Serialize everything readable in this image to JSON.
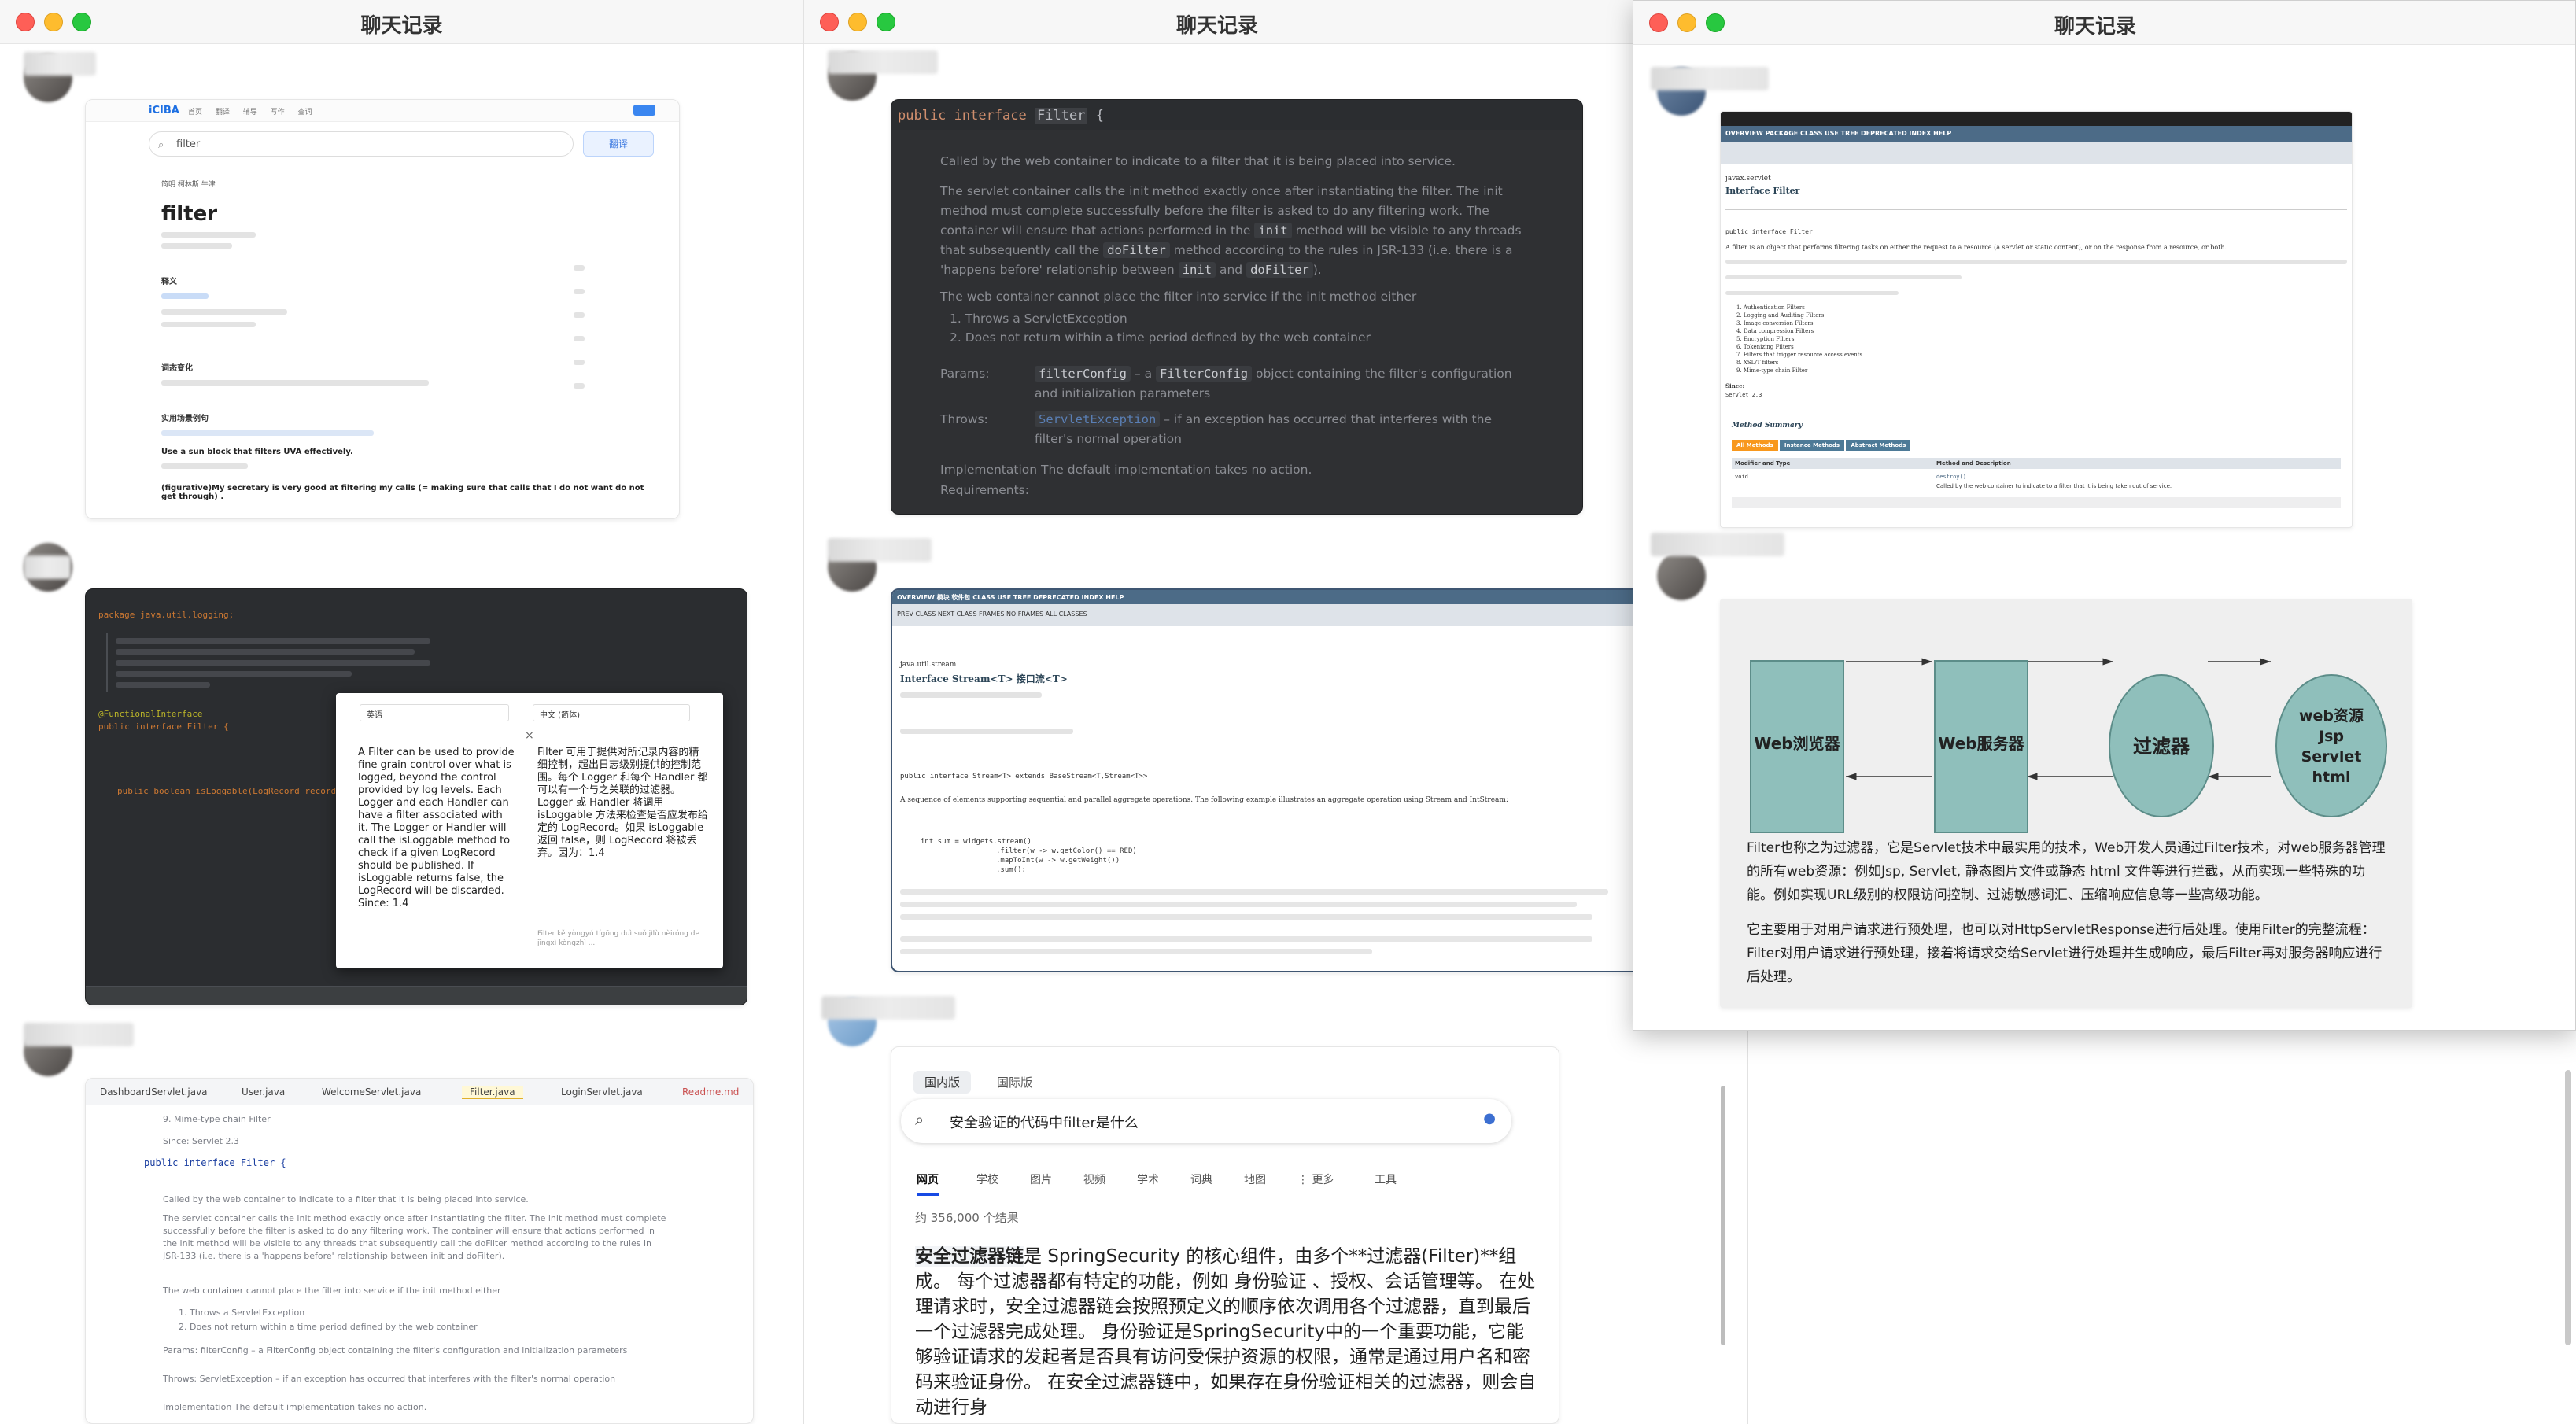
{
  "windows": [
    {
      "title": "聊天记录"
    },
    {
      "title": "聊天记录"
    },
    {
      "title": "聊天记录"
    }
  ],
  "dict": {
    "logo": "iCIBA",
    "nav": "首页 翻译 辅导 写作 查词",
    "search": "filter",
    "button": "翻译",
    "tabs": "简明 柯林斯 牛津",
    "word": "filter",
    "section1": "释义",
    "section2": "词态变化",
    "section3": "实用场景例句",
    "ex1": "Use a sun block that filters UVA effectively.",
    "ex2": "(figurative)My secretary is very good at filtering my calls (= making sure that calls that I do not want do not get through) ."
  },
  "ide_dark": {
    "code": [
      "package java.util.logging;",
      "@FunctionalInterface",
      "public interface Filter {",
      "public boolean isLoggable(LogRecord record);"
    ],
    "popup_src_lang": "英语",
    "popup_dst_lang": "中文 (简体)",
    "popup_en": "A Filter can be used to provide fine grain control over what is logged, beyond the control provided by log levels. Each Logger and each Handler can have a filter associated with it. The Logger or Handler will call the isLoggable method to check if a given LogRecord should be published. If isLoggable returns false, the LogRecord will be discarded. Since: 1.4",
    "popup_zh": "Filter 可用于提供对所记录内容的精细控制，超出日志级别提供的控制范围。每个 Logger 和每个 Handler 都可以有一个与之关联的过滤器。Logger 或 Handler 将调用 isLoggable 方法来检查是否应发布给定的 LogRecord。如果 isLoggable 返回 false，则 LogRecord 将被丢弃。因为：1.4",
    "popup_pinyin": "Filter kě yòngyú tígōng duì suǒ jìlù nèiróng de jīngxì kòngzhì ..."
  },
  "ide_light": {
    "tabs": [
      "DashboardServlet.java",
      "User.java",
      "WelcomeServlet.java",
      "Filter.java",
      "LoginServlet.java",
      "Readme.md"
    ],
    "line1": "9. Mime-type chain Filter",
    "line2": "Since: Servlet 2.3",
    "decl": "public interface Filter {",
    "doc1": "Called by the web container to indicate to a filter that it is being placed into service.",
    "doc2": "The servlet container calls the init method exactly once after instantiating the filter. The init method must complete successfully before the filter is asked to do any filtering work. The container will ensure that actions performed in the init method will be visible to any threads that subsequently call the doFilter method according to the rules in JSR-133 (i.e. there is a 'happens before' relationship between init and doFilter).",
    "doc3": "The web container cannot place the filter into service if the init method either",
    "doc4": "1. Throws a ServletException",
    "doc5": "2. Does not return within a time period defined by the web container",
    "params": "Params: filterConfig – a FilterConfig object containing the filter's configuration and initialization parameters",
    "throws": "Throws: ServletException – if an exception has occurred that interferes with the filter's normal operation",
    "impl": "Implementation The default implementation takes no action."
  },
  "javadoc_dark": {
    "decl_prefix": "public interface",
    "decl_name": "Filter",
    "decl_suffix": "{",
    "p1": "Called by the web container to indicate to a filter that it is being placed into service.",
    "p2a": "The servlet container calls the init method exactly once after instantiating the filter. The init method must complete successfully before the filter is asked to do any filtering work. The container will ensure that actions performed in the",
    "chip_init": "init",
    "p2b": "method will be visible to any threads that subsequently call the",
    "chip_dofilter": "doFilter",
    "p2c": "method according to the rules in JSR-133 (i.e. there is a 'happens before' relationship between",
    "p2d": "and",
    "p3": "The web container cannot place the filter into service if the init method either",
    "l1": "1. Throws a ServletException",
    "l2": "2. Does not return within a time period defined by the web container",
    "params_label": "Params:",
    "params_chip1": "filterConfig",
    "params_mid": "– a",
    "params_chip2": "FilterConfig",
    "params_text": "object containing the filter's configuration and initialization parameters",
    "throws_label": "Throws:",
    "throws_chip": "ServletException",
    "throws_text": "– if an exception has occurred that interferes with the filter's normal operation",
    "impl": "Implementation The default implementation takes no action.",
    "req": "Requirements:"
  },
  "stream_doc": {
    "menu": "OVERVIEW 模块 软件包 CLASS USE TREE DEPRECATED INDEX HELP",
    "sub": "PREV CLASS  NEXT CLASS  FRAMES  NO FRAMES  ALL CLASSES",
    "pkg": "java.util.stream",
    "title": "Interface Stream<T> 接口流<T>",
    "decl": "public interface Stream<T> extends BaseStream<T,Stream<T>>",
    "desc": "A sequence of elements supporting sequential and parallel aggregate operations. The following example illustrates an aggregate operation using Stream and IntStream:",
    "code": [
      "int sum = widgets.stream()",
      ".filter(w -> w.getColor() == RED)",
      ".mapToInt(w -> w.getWeight())",
      ".sum();"
    ]
  },
  "oracle_filter": {
    "menu": "OVERVIEW PACKAGE CLASS USE TREE DEPRECATED INDEX HELP",
    "pkg": "javax.servlet",
    "title": "Interface Filter",
    "decl": "public interface Filter",
    "desc": "A filter is an object that performs filtering tasks on either the request to a resource (a servlet or static content), or on the response from a resource, or both.",
    "list": [
      "1. Authentication Filters",
      "2. Logging and Auditing Filters",
      "3. Image conversion Filters",
      "4. Data compression Filters",
      "5. Encryption Filters",
      "6. Tokenizing Filters",
      "7. Filters that trigger resource access events",
      "8. XSL/T filters",
      "9. Mime-type chain Filter"
    ],
    "since_label": "Since:",
    "since": "Servlet 2.3",
    "summary": "Method Summary",
    "btns": [
      "All Methods",
      "Instance Methods",
      "Abstract Methods"
    ],
    "col1": "Modifier and Type",
    "col2": "Method and Description",
    "row_type": "void",
    "row_method": "destroy()",
    "row_desc": "Called by the web container to indicate to a filter that it is being taken out of service."
  },
  "diagram": {
    "nodes": [
      "Web浏览器",
      "Web服务器",
      "过滤器",
      "web资源 Jsp Servlet html"
    ],
    "p1": "Filter也称之为过滤器，它是Servlet技术中最实用的技术，Web开发人员通过Filter技术，对web服务器管理的所有web资源：例如Jsp, Servlet, 静态图片文件或静态 html 文件等进行拦截，从而实现一些特殊的功能。例如实现URL级别的权限访问控制、过滤敏感词汇、压缩响应信息等一些高级功能。",
    "p2": "它主要用于对用户请求进行预处理，也可以对HttpServletResponse进行后处理。使用Filter的完整流程：Filter对用户请求进行预处理，接着将请求交给Servlet进行处理并生成响应，最后Filter再对服务器响应进行后处理。"
  },
  "search": {
    "seg_active": "国内版",
    "seg_other": "国际版",
    "query": "安全验证的代码中filter是什么",
    "tabs": [
      "网页",
      "学校",
      "图片",
      "视频",
      "学术",
      "词典",
      "地图",
      "⋮ 更多",
      "工具"
    ],
    "count": "约 356,000 个结果",
    "result_bold": "安全过滤器链",
    "result": "是 SpringSecurity 的核心组件，由多个**过滤器(Filter)**组成。 每个过滤器都有特定的功能，例如 身份验证 、授权、会话管理等。 在处理请求时，安全过滤器链会按照预定义的顺序依次调用各个过滤器，直到最后一个过滤器完成处理。 身份验证是SpringSecurity中的一个重要功能，它能够验证请求的发起者是否具有访问受保护资源的权限，通常是通过用户名和密码来验证身份。 在安全过滤器链中，如果存在身份验证相关的过滤器，则会自动进行身"
  },
  "colors": {
    "accent": "#1d6fe2",
    "oracle_blue": "#4c6b87",
    "diagram_fill": "#8fbfbb",
    "dark_bg": "#2b2d30"
  }
}
